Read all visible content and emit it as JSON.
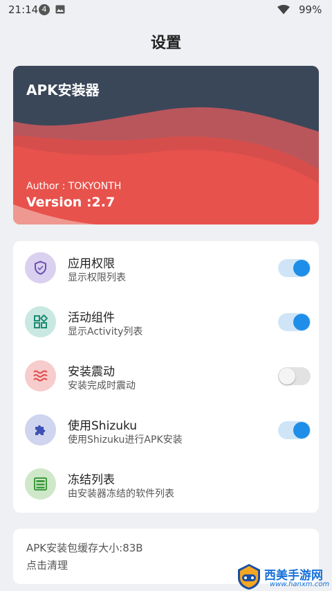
{
  "status_bar": {
    "time": "21:14",
    "notification_count": "4",
    "battery_percent": "99%",
    "icons": [
      "image-icon",
      "wifi-icon"
    ]
  },
  "page": {
    "title": "设置"
  },
  "banner": {
    "app_name": "APK安装器",
    "author": "Author : TOKYONTH",
    "version": "Version :2.7",
    "colors": {
      "top": "#3a4759",
      "bottom": "#e8524c"
    }
  },
  "settings": [
    {
      "title": "应用权限",
      "subtitle": "显示权限列表",
      "icon": "shield-icon",
      "toggle": true,
      "icon_bg": "#d9d1ef",
      "icon_color": "#6a4fb3"
    },
    {
      "title": "活动组件",
      "subtitle": "显示Activity列表",
      "icon": "widgets-icon",
      "toggle": true,
      "icon_bg": "#c9e8e1",
      "icon_color": "#1f8a73"
    },
    {
      "title": "安装震动",
      "subtitle": "安装完成时震动",
      "icon": "vibration-icon",
      "toggle": false,
      "icon_bg": "#f7cccc",
      "icon_color": "#e04646"
    },
    {
      "title": "使用Shizuku",
      "subtitle": "使用Shizuku进行APK安装",
      "icon": "puzzle-icon",
      "toggle": true,
      "icon_bg": "#cfd5ee",
      "icon_color": "#3f51b5"
    },
    {
      "title": "冻结列表",
      "subtitle": "由安装器冻结的软件列表",
      "icon": "freeze-list-icon",
      "toggle": null,
      "icon_bg": "#cfe8c9",
      "icon_color": "#3c9a3c"
    }
  ],
  "cache": {
    "size_label": "APK安装包缓存大小:83B",
    "clear_label": "点击清理"
  },
  "watermark": {
    "brand": "西美手游网",
    "url": "www.hanxm.com"
  },
  "accent_color": "#1e8ee8"
}
